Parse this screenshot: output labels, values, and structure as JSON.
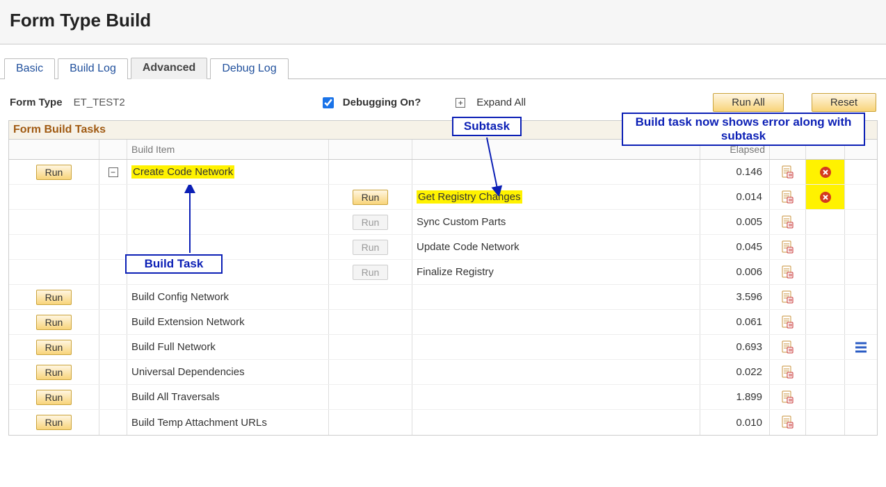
{
  "page": {
    "title": "Form Type Build"
  },
  "tabs": {
    "basic": "Basic",
    "build_log": "Build Log",
    "advanced": "Advanced",
    "debug_log": "Debug Log"
  },
  "controls": {
    "form_type_label": "Form Type",
    "form_type_value": "ET_TEST2",
    "debugging_label": "Debugging On?",
    "expand_all_label": "Expand All",
    "run_all_label": "Run All",
    "reset_label": "Reset"
  },
  "grid": {
    "title": "Form Build Tasks",
    "header": {
      "build_item": "Build Item",
      "elapsed": "Elapsed"
    },
    "run_label": "Run",
    "rows": {
      "r0": {
        "item": "Create Code Network",
        "sub": "",
        "elapsed": "0.146",
        "expanded": true
      },
      "r1": {
        "item": "",
        "sub": "Get Registry Changes",
        "elapsed": "0.014"
      },
      "r2": {
        "item": "",
        "sub": "Sync Custom Parts",
        "elapsed": "0.005"
      },
      "r3": {
        "item": "",
        "sub": "Update Code Network",
        "elapsed": "0.045"
      },
      "r4": {
        "item": "",
        "sub": "Finalize Registry",
        "elapsed": "0.006"
      },
      "r5": {
        "item": "Build Config Network",
        "sub": "",
        "elapsed": "3.596"
      },
      "r6": {
        "item": "Build Extension Network",
        "sub": "",
        "elapsed": "0.061"
      },
      "r7": {
        "item": "Build Full Network",
        "sub": "",
        "elapsed": "0.693"
      },
      "r8": {
        "item": "Universal Dependencies",
        "sub": "",
        "elapsed": "0.022"
      },
      "r9": {
        "item": "Build All Traversals",
        "sub": "",
        "elapsed": "1.899"
      },
      "r10": {
        "item": "Build Temp Attachment URLs",
        "sub": "",
        "elapsed": "0.010"
      }
    }
  },
  "annotations": {
    "subtask": "Subtask",
    "build_task": "Build Task",
    "error_note": "Build task now shows error along with subtask"
  }
}
